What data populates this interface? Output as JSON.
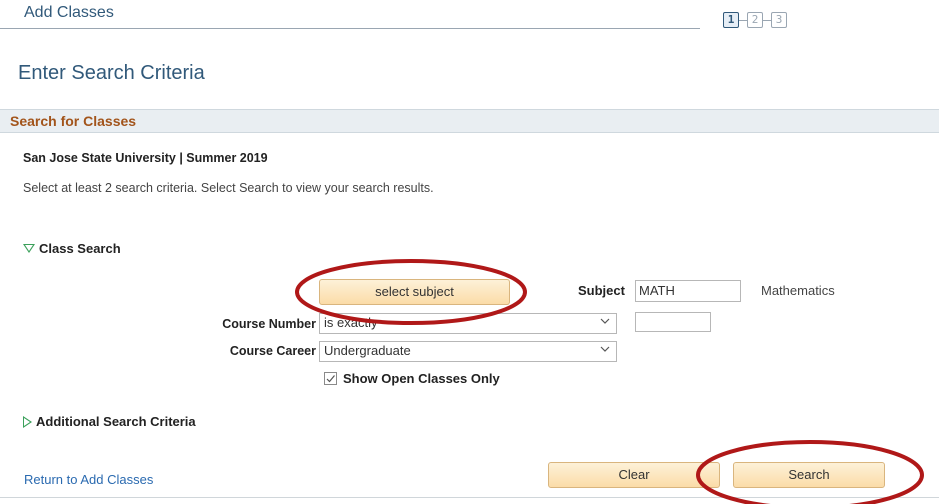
{
  "header": {
    "title": "Add Classes",
    "steps": [
      "1",
      "2",
      "3"
    ]
  },
  "page_title": "Enter Search Criteria",
  "section": {
    "label": "Search for Classes",
    "institution_term": "San Jose State University | Summer 2019",
    "instruction": "Select at least 2 search criteria. Select Search to view your search results."
  },
  "class_search": {
    "label": "Class Search",
    "select_subject_label": "select subject",
    "subject_label": "Subject",
    "subject_value": "MATH",
    "subject_description": "Mathematics",
    "course_number_label": "Course Number",
    "course_number_operator": "is exactly",
    "course_number_value": "",
    "course_career_label": "Course Career",
    "course_career_value": "Undergraduate",
    "show_open_label": "Show Open Classes Only",
    "show_open_checked": true
  },
  "additional_criteria_label": "Additional Search Criteria",
  "footer": {
    "return_link": "Return to Add Classes",
    "clear_label": "Clear",
    "search_label": "Search"
  },
  "colors": {
    "heading": "#31597a",
    "section_label": "#a2541b",
    "button_fill": "#fbdca8",
    "expand_triangle": "#3aa05a",
    "annotation_ellipse": "#b01818",
    "link": "#2a6ab0"
  },
  "icons": {
    "expanded": "triangle-down-icon",
    "collapsed": "triangle-right-icon",
    "dropdown": "chevron-down-icon",
    "checkbox": "checkmark-icon"
  }
}
